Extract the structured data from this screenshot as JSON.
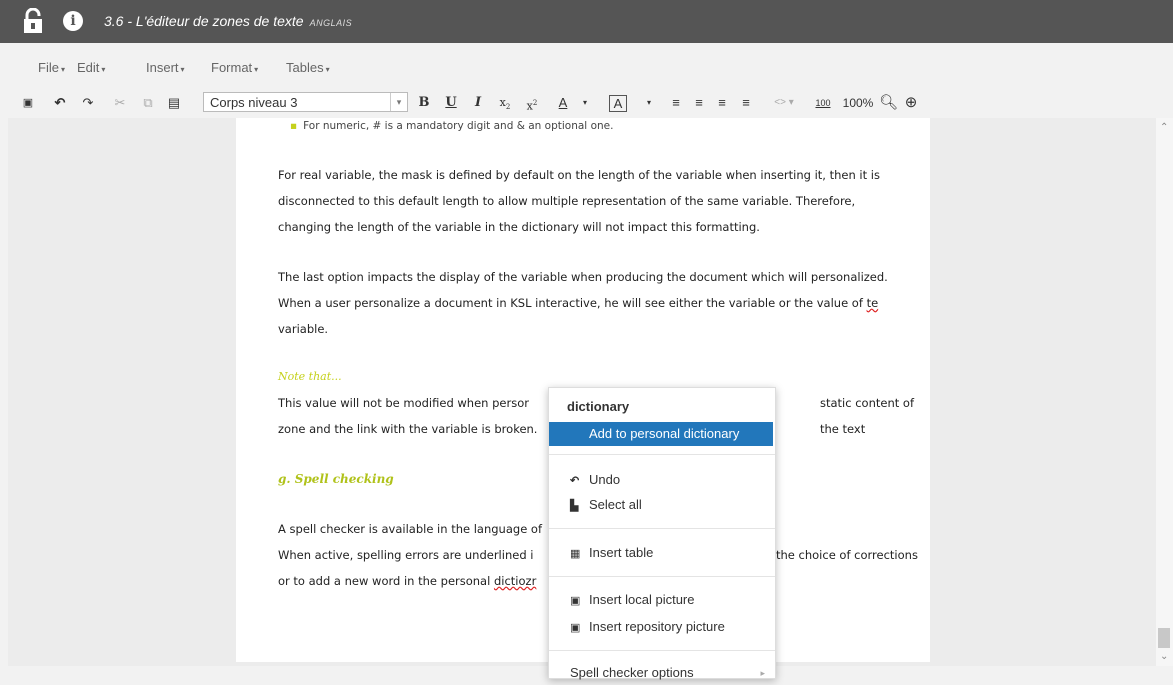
{
  "topbar": {
    "title": "3.6 - L'éditeur de zones de texte",
    "language": "ANGLAIS"
  },
  "menubar": [
    "File",
    "Edit",
    "Insert",
    "Format",
    "Tables"
  ],
  "toolbar": {
    "paragraph_style": "Corps niveau 3",
    "zoom_value": "100",
    "zoom_label": "100%"
  },
  "document": {
    "bullet": "For numeric, # is a mandatory digit and & an optional one.",
    "para1": [
      "For real variable, the mask is defined by default on the length of the variable when inserting it, then it is",
      "disconnected to this default length to allow multiple representation of the same variable. Therefore,",
      "changing the length of the variable in the dictionary will not impact this formatting."
    ],
    "para2": [
      "The last option impacts the display of the variable when producing the document which will personalized.",
      "When a user personalize a document in KSL interactive, he will see either the variable or the value of ",
      "te",
      "variable."
    ],
    "note_label": "Note that...",
    "para3a": "This value will not be modified when persor",
    "para3b": "static content of the text",
    "para3c": "zone and the link with the variable is broken.",
    "heading": "g.  Spell checking",
    "para4a": "A spell checker is available in the language of",
    "para4b": "When active, spelling errors are underlined i",
    "para4c": "the choice of corrections",
    "para4d": "or to add a new word in the personal ",
    "para4e": "dictiozr"
  },
  "context_menu": {
    "suggestion": "dictionary",
    "add_to_dict": "Add to personal dictionary",
    "undo": "Undo",
    "select_all": "Select all",
    "insert_table": "Insert table",
    "insert_local_picture": "Insert local picture",
    "insert_repository_picture": "Insert repository picture",
    "spell_options": "Spell checker options"
  }
}
